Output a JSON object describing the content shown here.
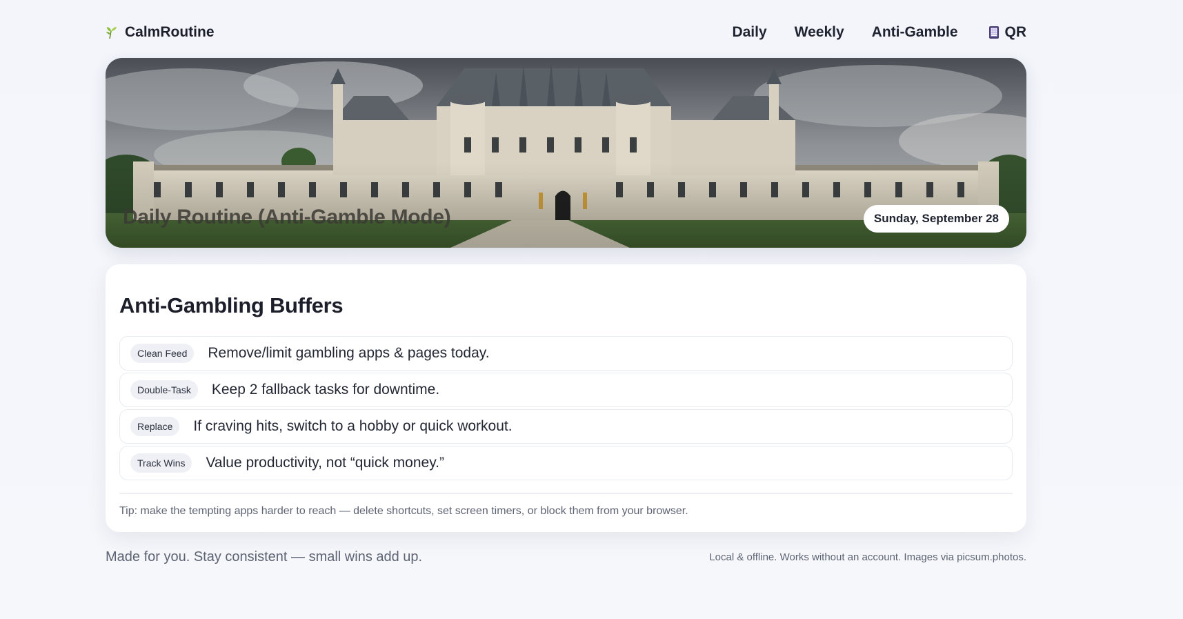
{
  "brand": {
    "icon": "sprout-icon",
    "name": "CalmRoutine"
  },
  "nav": {
    "items": [
      {
        "label": "Daily"
      },
      {
        "label": "Weekly"
      },
      {
        "label": "Anti-Gamble"
      }
    ],
    "qr": {
      "icon": "phone-icon",
      "label": "QR"
    }
  },
  "hero": {
    "image": "castle-photo",
    "title": "Daily Routine (Anti-Gamble Mode)",
    "date": "Sunday, September 28"
  },
  "buffers": {
    "title": "Anti-Gambling Buffers",
    "items": [
      {
        "tag": "Clean Feed",
        "text": "Remove/limit gambling apps & pages today."
      },
      {
        "tag": "Double-Task",
        "text": "Keep 2 fallback tasks for downtime."
      },
      {
        "tag": "Replace",
        "text": "If craving hits, switch to a hobby or quick workout."
      },
      {
        "tag": "Track Wins",
        "text": "Value productivity, not “quick money.”"
      }
    ],
    "tip": "Tip: make the tempting apps harder to reach — delete shortcuts, set screen timers, or block them from your browser."
  },
  "footer": {
    "left": "Made for you. Stay consistent — small wins add up.",
    "right": "Local & offline. Works without an account. Images via picsum.photos."
  },
  "colors": {
    "background": "#f4f6fb",
    "text": "#1f2330",
    "muted": "#5d6372",
    "tag_bg": "#eef0f5",
    "card": "#ffffff"
  }
}
